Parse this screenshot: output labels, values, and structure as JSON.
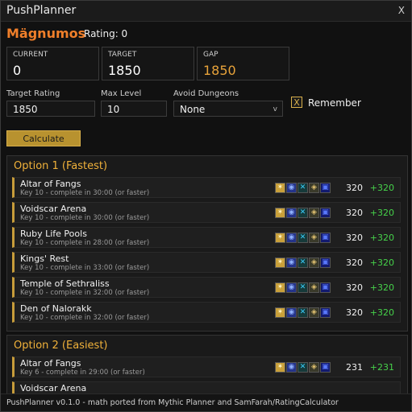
{
  "window": {
    "title": "PushPlanner",
    "close_label": "X"
  },
  "character": {
    "name": "Mägnumos",
    "rating_text": "Rating: 0"
  },
  "stats": [
    {
      "label": "CURRENT",
      "value": "0"
    },
    {
      "label": "TARGET",
      "value": "1850"
    },
    {
      "label": "GAP",
      "value": "1850"
    }
  ],
  "inputs": {
    "target_rating": {
      "label": "Target Rating",
      "value": "1850"
    },
    "max_level": {
      "label": "Max Level",
      "value": "10"
    },
    "avoid_dungeons": {
      "label": "Avoid Dungeons",
      "value": "None"
    }
  },
  "remember": {
    "checked_mark": "X",
    "label": "Remember"
  },
  "calculate_label": "Calculate",
  "options": [
    {
      "title": "Option 1 (Fastest)",
      "rows": [
        {
          "name": "Altar of Fangs",
          "detail": "Key 10 - complete in 30:00 (or faster)",
          "score": "320",
          "delta": "+320"
        },
        {
          "name": "Voidscar Arena",
          "detail": "Key 10 - complete in 30:00 (or faster)",
          "score": "320",
          "delta": "+320"
        },
        {
          "name": "Ruby Life Pools",
          "detail": "Key 10 - complete in 28:00 (or faster)",
          "score": "320",
          "delta": "+320"
        },
        {
          "name": "Kings' Rest",
          "detail": "Key 10 - complete in 33:00 (or faster)",
          "score": "320",
          "delta": "+320"
        },
        {
          "name": "Temple of Sethraliss",
          "detail": "Key 10 - complete in 32:00 (or faster)",
          "score": "320",
          "delta": "+320"
        },
        {
          "name": "Den of Nalorakk",
          "detail": "Key 10 - complete in 32:00 (or faster)",
          "score": "320",
          "delta": "+320"
        }
      ]
    },
    {
      "title": "Option 2 (Easiest)",
      "rows": [
        {
          "name": "Altar of Fangs",
          "detail": "Key 6 - complete in 29:00 (or faster)",
          "score": "231",
          "delta": "+231"
        },
        {
          "name": "Voidscar Arena",
          "detail": "",
          "score": "",
          "delta": ""
        }
      ]
    }
  ],
  "affix_icons": [
    "fortified-icon",
    "bolstering-icon",
    "spiteful-icon",
    "tyrannical-icon",
    "storming-icon"
  ],
  "colors": {
    "accent": "#f0b13a",
    "name": "#f07f2a",
    "gain": "#46d24a",
    "button": "#b8922f"
  },
  "footer_text": "PushPlanner v0.1.0 - math ported from Mythic Planner and SamFarah/RatingCalculator"
}
